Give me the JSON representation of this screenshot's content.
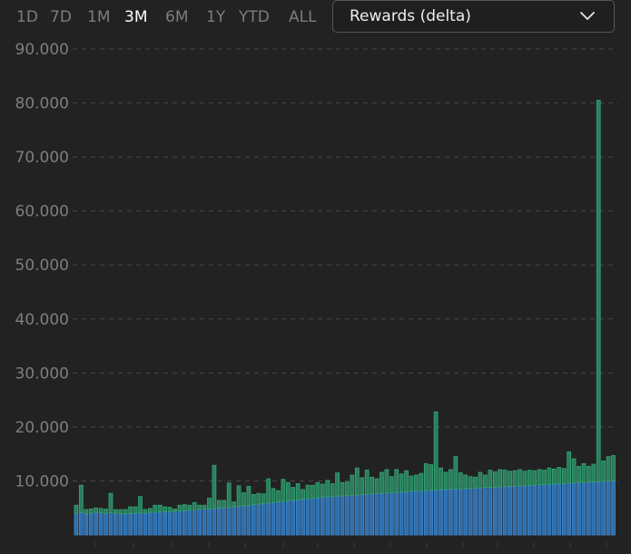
{
  "timeframes": {
    "items": [
      "1D",
      "7D",
      "1M",
      "3M",
      "6M",
      "1Y",
      "YTD",
      "ALL"
    ],
    "active": "3M"
  },
  "metric_select": {
    "value": "Rewards (delta)"
  },
  "chart_data": {
    "type": "bar",
    "stacked": true,
    "title": "",
    "xlabel": "",
    "ylabel": "",
    "ylim": [
      0,
      90000
    ],
    "yticks": [
      10000,
      20000,
      30000,
      40000,
      50000,
      60000,
      70000,
      80000,
      90000
    ],
    "ytick_labels": [
      "10.000",
      "20.000",
      "30.000",
      "40.000",
      "50.000",
      "60.000",
      "70.000",
      "80.000",
      "90.000"
    ],
    "grid": "horizontal dashed",
    "colors": {
      "base": "#3f86c9",
      "top": "#35a878",
      "background": "#222223"
    },
    "series": [
      {
        "values": [
          4000,
          4200,
          3900,
          4000,
          4200,
          4100,
          4000,
          4100,
          4000,
          3900,
          3900,
          4000,
          4000,
          4100,
          4000,
          4200,
          4200,
          4300,
          4300,
          4300,
          4400,
          4400,
          4500,
          4600,
          4600,
          4700,
          4800,
          4800,
          4900,
          5000,
          5000,
          5100,
          5200,
          5300,
          5400,
          5500,
          5600,
          5700,
          5800,
          5900,
          6000,
          6100,
          6200,
          6300,
          6400,
          6500,
          6600,
          6700,
          6800,
          6900,
          7000,
          7100,
          7100,
          7200,
          7200,
          7300,
          7300,
          7400,
          7500,
          7500,
          7600,
          7700,
          7700,
          7800,
          7800,
          7900,
          8000,
          8000,
          8100,
          8100,
          8200,
          8200,
          8300,
          8300,
          8400,
          8400,
          8500,
          8500,
          8500,
          8600,
          8600,
          8700,
          8700,
          8800,
          8800,
          8800,
          8900,
          8900,
          9000,
          9000,
          9100,
          9100,
          9200,
          9200,
          9300,
          9300,
          9400,
          9400,
          9500,
          9500,
          9600,
          9600,
          9700,
          9700,
          9800,
          9800,
          9900,
          9900,
          10000,
          10000
        ]
      },
      {
        "values": [
          1500,
          5000,
          800,
          800,
          800,
          800,
          800,
          3600,
          700,
          800,
          800,
          1200,
          1200,
          3000,
          700,
          700,
          1300,
          1200,
          900,
          800,
          400,
          1100,
          1100,
          900,
          1400,
          800,
          700,
          2000,
          8000,
          1400,
          1400,
          4500,
          900,
          3800,
          2400,
          3500,
          1900,
          2000,
          1800,
          4500,
          2600,
          2100,
          4100,
          3400,
          2400,
          3000,
          1800,
          2500,
          2400,
          2800,
          2400,
          3000,
          2400,
          4300,
          2500,
          2500,
          3800,
          5000,
          3100,
          4500,
          3100,
          2700,
          3900,
          4300,
          3000,
          4200,
          3300,
          3900,
          2800,
          3000,
          3200,
          5000,
          4700,
          14500,
          4000,
          3200,
          3600,
          6000,
          3000,
          2500,
          2200,
          2000,
          2900,
          2300,
          3200,
          2900,
          3200,
          3100,
          2800,
          2900,
          3000,
          2700,
          2800,
          2700,
          2800,
          2700,
          3000,
          2800,
          3000,
          2800,
          5800,
          4500,
          3000,
          3500,
          2900,
          3300,
          70600,
          3800,
          4500,
          4700
        ]
      }
    ]
  }
}
